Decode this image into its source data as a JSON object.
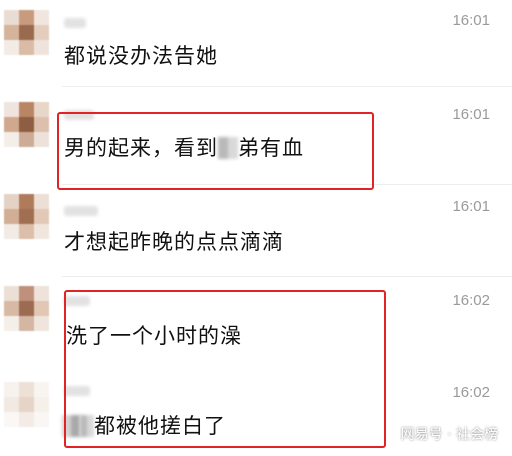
{
  "messages": [
    {
      "time": "16:01",
      "text": "都说没办法告她"
    },
    {
      "time": "16:01",
      "text_before": "男的起来，看到",
      "text_after": "弟有血"
    },
    {
      "time": "16:01",
      "text": "才想起昨晚的点点滴滴"
    },
    {
      "time": "16:02",
      "text": "洗了一个小时的澡"
    },
    {
      "time": "16:02",
      "text_after": "都被他搓白了"
    }
  ],
  "watermark": "网易号 · 社会榜",
  "colors": {
    "highlight_border": "#e02424",
    "timestamp": "#9a9a9a",
    "message_text": "#111111",
    "divider": "#ededed"
  }
}
